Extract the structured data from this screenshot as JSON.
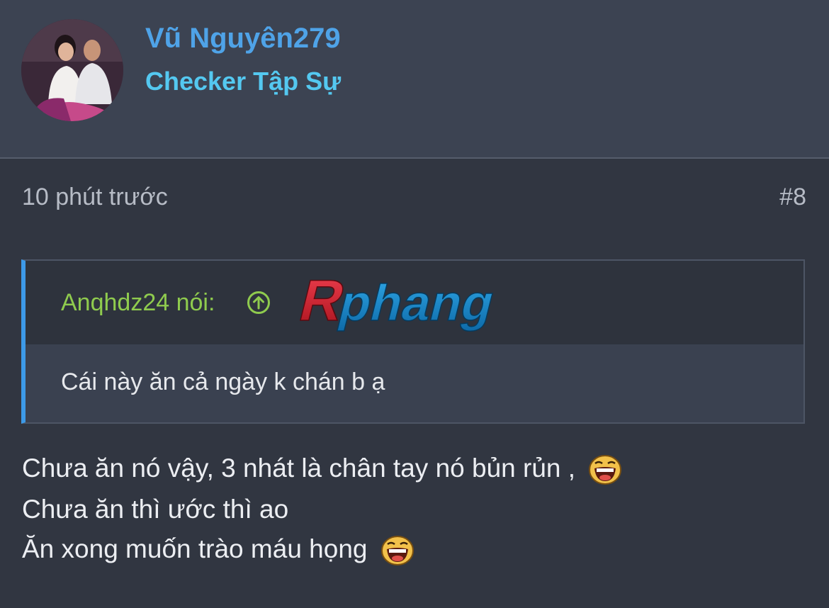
{
  "post": {
    "username": "Vũ Nguyên279",
    "user_title": "Checker Tập Sự",
    "timestamp": "10 phút trước",
    "post_number": "#8"
  },
  "quote": {
    "author_label": "Anqhdz24 nói:",
    "logo_text": "Rphang",
    "text": "Cái này ăn cả ngày k chán b ạ"
  },
  "message": {
    "lines": [
      "Chưa ăn nó vậy, 3 nhát là chân tay nó bủn rủn ,",
      "Chưa ăn thì ước thì ao",
      "Ăn xong muốn trào máu họng"
    ],
    "emoji": "laughing-emoji"
  },
  "colors": {
    "username": "#4fa3e8",
    "user_title": "#54c8f0",
    "quote_author": "#8fcb4e",
    "quote_accent": "#3d9ae8",
    "logo_red": "#d21f2b",
    "logo_blue": "#1c8fd0"
  }
}
